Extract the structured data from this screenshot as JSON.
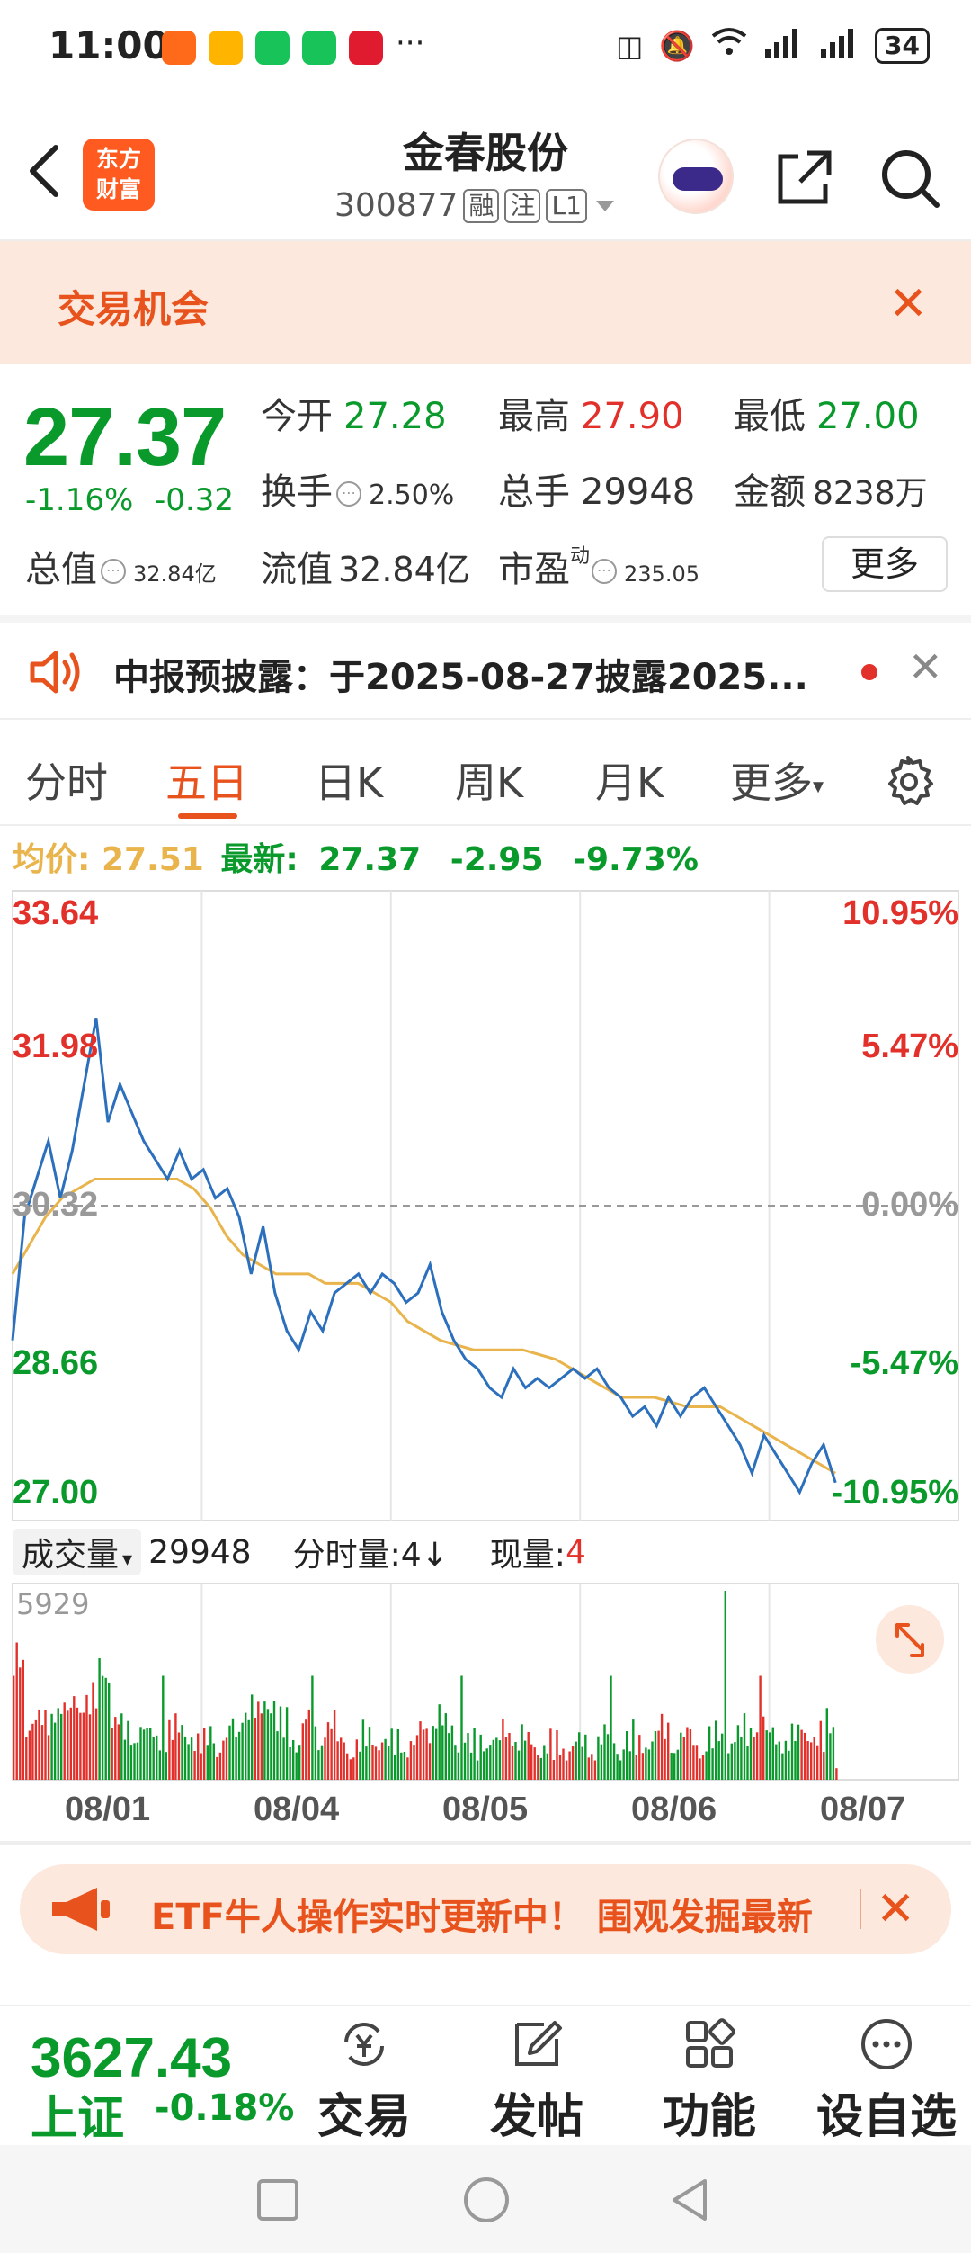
{
  "status_bar": {
    "time": "11:00",
    "more": "···",
    "battery": "34"
  },
  "header": {
    "brand_line1": "东方",
    "brand_line2": "财富",
    "stock_name": "金春股份",
    "stock_code": "300877",
    "tags": [
      "融",
      "注",
      "L1"
    ]
  },
  "banner": {
    "title": "交易机会",
    "close": "✕"
  },
  "quote": {
    "price": "27.37",
    "change_pct": "-1.16%",
    "change_amt": "-0.32",
    "open_label": "今开",
    "open": "27.28",
    "high_label": "最高",
    "high": "27.90",
    "low_label": "最低",
    "low": "27.00",
    "turnover_label": "换手",
    "turnover": "2.50%",
    "volume_label": "总手",
    "volume": "29948",
    "amount_label": "金额",
    "amount": "8238万",
    "mktcap_label": "总值",
    "mktcap": "32.84亿",
    "float_label": "流值",
    "float": "32.84亿",
    "pe_label": "市盈",
    "pe_sup": "动",
    "pe": "235.05",
    "more_button": "更多"
  },
  "notice": {
    "text": "中报预披露：于2025-08-27披露2025...",
    "close": "✕"
  },
  "tabs": {
    "items": [
      "分时",
      "五日",
      "日K",
      "周K",
      "月K",
      "更多"
    ],
    "active": "五日"
  },
  "chart_header": {
    "avg_label": "均价:",
    "avg_value": "27.51",
    "last_label": "最新:",
    "last_value": "27.37",
    "chg": "-2.95",
    "chg_pct": "-9.73%"
  },
  "volume_header": {
    "selector": "成交量",
    "total": "29948",
    "tick_label": "分时量:4↓",
    "now_label": "现量:",
    "now_value": "4"
  },
  "ad": {
    "text": "ETF牛人操作实时更新中！ 围观发掘最新",
    "close": "✕"
  },
  "bottom_nav": {
    "index_value": "3627.43",
    "index_name": "上证",
    "index_change": "-0.18%",
    "buttons": [
      "交易",
      "发帖",
      "功能",
      "设自选"
    ]
  },
  "chart_data": {
    "type": "line",
    "x": [
      "08/01",
      "08/04",
      "08/05",
      "08/06",
      "08/07"
    ],
    "y_left_ticks": [
      "33.64",
      "31.98",
      "30.32",
      "28.66",
      "27.00"
    ],
    "y_right_ticks": [
      "10.95%",
      "5.47%",
      "0.00%",
      "-5.47%",
      "-10.95%"
    ],
    "ylim": [
      27.0,
      33.64
    ],
    "prev_close": 30.32,
    "volume_max_label": "5929",
    "series": [
      {
        "name": "最新",
        "color": "#2b6fbd",
        "values": [
          28.9,
          30.2,
          30.6,
          31.0,
          30.4,
          30.9,
          31.6,
          32.3,
          31.2,
          31.6,
          31.3,
          31.0,
          30.8,
          30.6,
          30.9,
          30.6,
          30.7,
          30.4,
          30.5,
          30.2,
          29.6,
          30.1,
          29.4,
          29.0,
          28.8,
          29.2,
          29.0,
          29.4,
          29.5,
          29.6,
          29.4,
          29.6,
          29.5,
          29.3,
          29.4,
          29.7,
          29.2,
          28.9,
          28.7,
          28.6,
          28.4,
          28.3,
          28.6,
          28.4,
          28.5,
          28.4,
          28.5,
          28.6,
          28.5,
          28.6,
          28.4,
          28.3,
          28.1,
          28.2,
          28.0,
          28.3,
          28.1,
          28.3,
          28.4,
          28.2,
          28.0,
          27.8,
          27.5,
          27.9,
          27.7,
          27.5,
          27.3,
          27.6,
          27.8,
          27.4
        ]
      },
      {
        "name": "均价",
        "color": "#e9b44c",
        "values": [
          29.6,
          29.9,
          30.2,
          30.4,
          30.5,
          30.6,
          30.6,
          30.6,
          30.6,
          30.6,
          30.6,
          30.5,
          30.3,
          30.0,
          29.8,
          29.7,
          29.6,
          29.6,
          29.6,
          29.5,
          29.5,
          29.5,
          29.4,
          29.3,
          29.1,
          29.0,
          28.9,
          28.85,
          28.8,
          28.8,
          28.8,
          28.8,
          28.75,
          28.7,
          28.6,
          28.5,
          28.4,
          28.3,
          28.3,
          28.3,
          28.25,
          28.2,
          28.2,
          28.2,
          28.1,
          28.0,
          27.9,
          27.8,
          27.7,
          27.6,
          27.5
        ]
      }
    ]
  }
}
